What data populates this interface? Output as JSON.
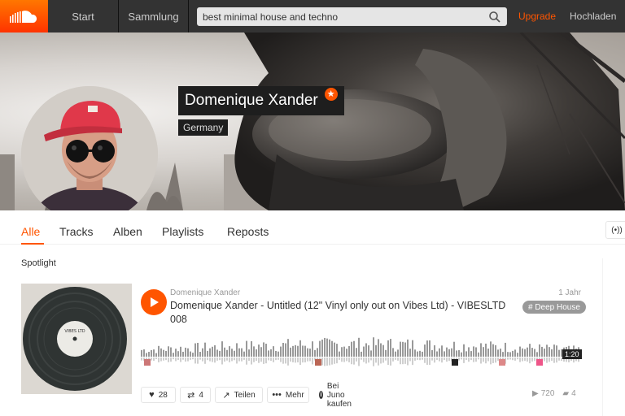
{
  "nav": {
    "logo_icon": "soundcloud-logo-icon",
    "start": "Start",
    "collection": "Sammlung",
    "search_value": "best minimal house and techno",
    "upgrade": "Upgrade",
    "upload": "Hochladen",
    "accent": "#ff5500"
  },
  "profile": {
    "name": "Domenique Xander",
    "country": "Germany",
    "pro_badge_icon": "star-icon"
  },
  "tabs": [
    "Alle",
    "Tracks",
    "Alben",
    "Playlists",
    "Reposts"
  ],
  "active_tab": "Alle",
  "stations_icon": "broadcast-icon",
  "spotlight": {
    "title": "Spotlight",
    "track": {
      "user": "Domenique Xander",
      "age": "1 Jahr",
      "title": "Domenique Xander - Untitled  (12\" Vinyl only out on Vibes Ltd) - VIBESLTD 008",
      "tag": "# Deep House",
      "duration": "1:20",
      "likes": "28",
      "reposts": "4",
      "share": "Teilen",
      "more": "Mehr",
      "buy": "Bei Juno kaufen",
      "plays": "720",
      "comments": "4",
      "vinyl_label": "VIBES LTD"
    }
  }
}
